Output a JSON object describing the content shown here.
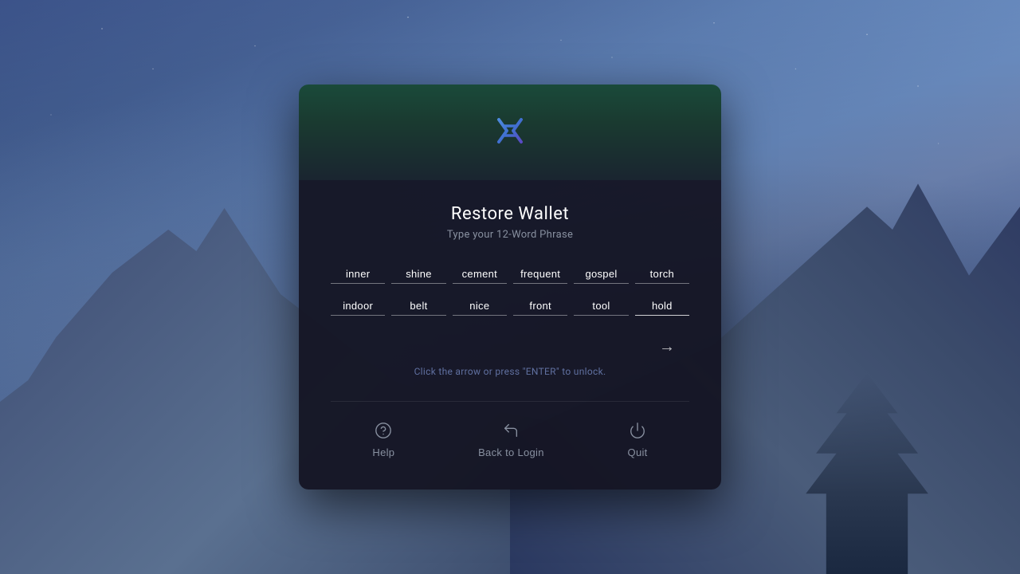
{
  "background": {
    "alt": "Mountain landscape at night with starry sky"
  },
  "modal": {
    "title": "Restore Wallet",
    "subtitle": "Type your 12-Word Phrase",
    "hint": "Click the arrow or press \"ENTER\" to unlock.",
    "words_row1": [
      {
        "id": 1,
        "value": "inner"
      },
      {
        "id": 2,
        "value": "shine"
      },
      {
        "id": 3,
        "value": "cement"
      },
      {
        "id": 4,
        "value": "frequent"
      },
      {
        "id": 5,
        "value": "gospel"
      },
      {
        "id": 6,
        "value": "torch"
      }
    ],
    "words_row2": [
      {
        "id": 7,
        "value": "indoor"
      },
      {
        "id": 8,
        "value": "belt"
      },
      {
        "id": 9,
        "value": "nice"
      },
      {
        "id": 10,
        "value": "front"
      },
      {
        "id": 11,
        "value": "tool"
      },
      {
        "id": 12,
        "value": "hold"
      }
    ],
    "arrow_label": "→",
    "actions": [
      {
        "id": "help",
        "label": "Help",
        "icon": "help-circle-icon"
      },
      {
        "id": "back-to-login",
        "label": "Back to Login",
        "icon": "back-icon"
      },
      {
        "id": "quit",
        "label": "Quit",
        "icon": "power-icon"
      }
    ]
  }
}
